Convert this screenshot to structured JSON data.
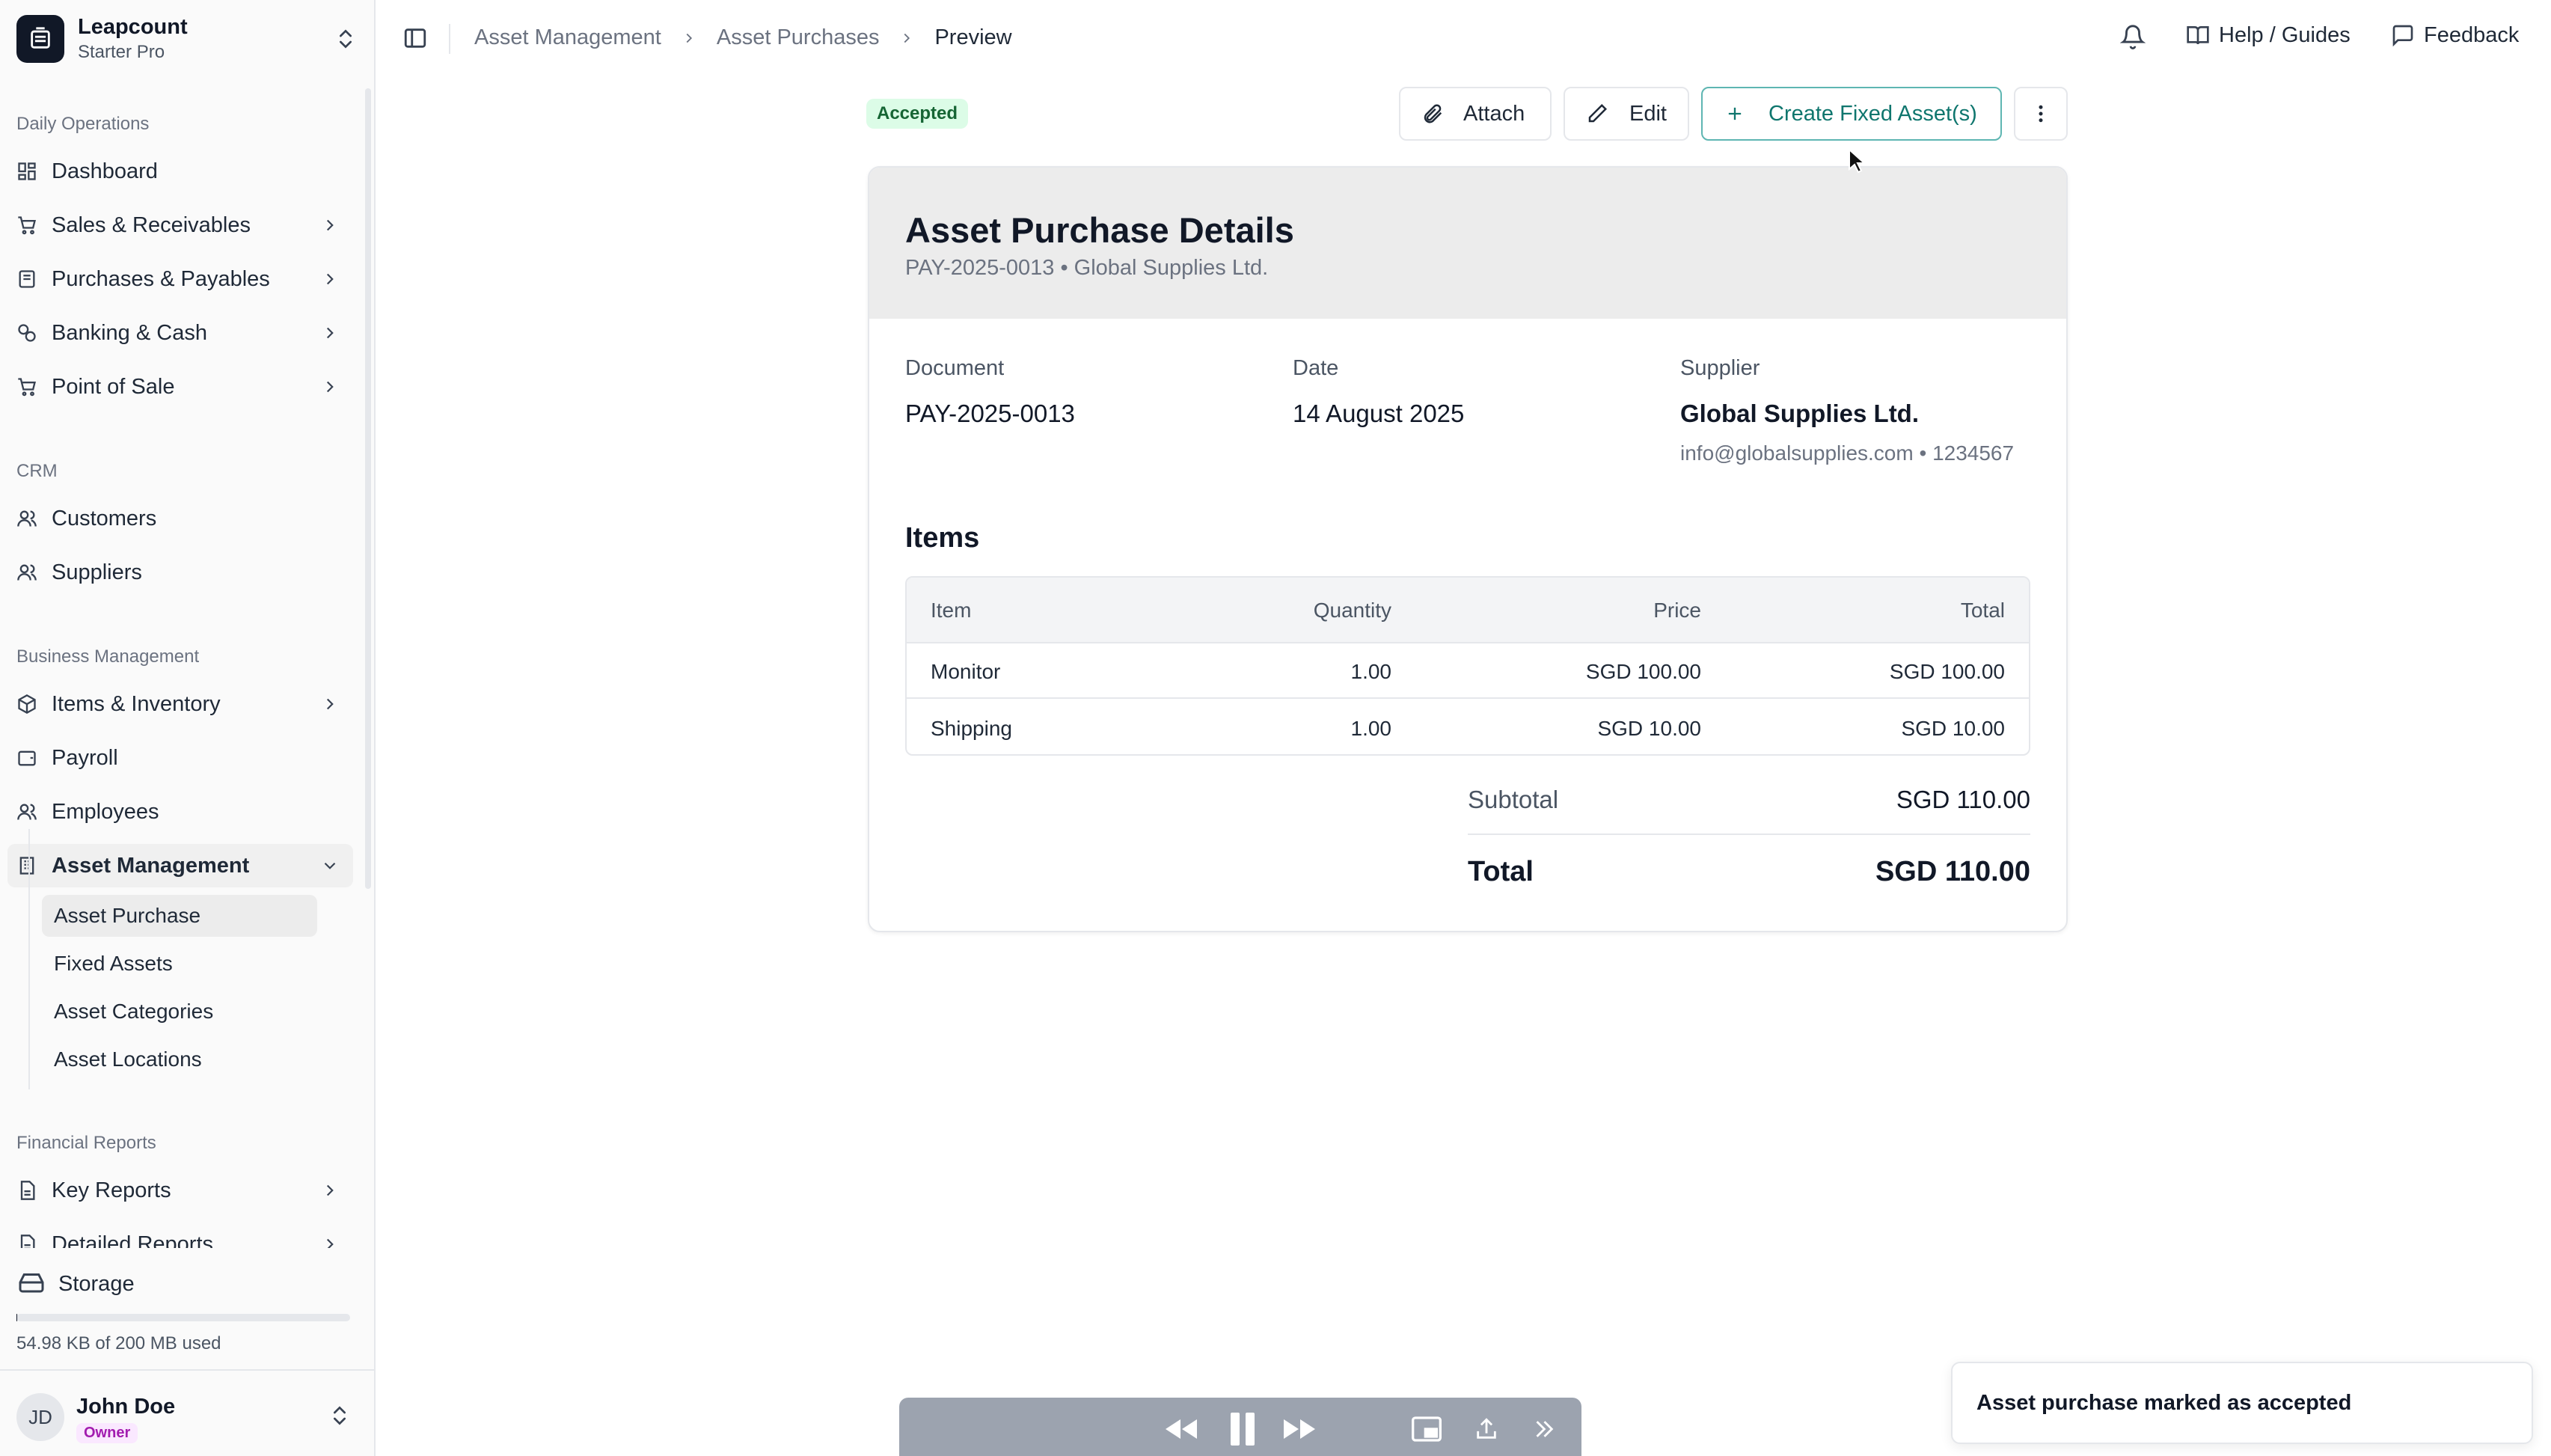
{
  "brand": {
    "name": "Leapcount",
    "plan": "Starter Pro"
  },
  "sidebar": {
    "sections": {
      "daily": "Daily Operations",
      "crm": "CRM",
      "business": "Business Management",
      "financial": "Financial Reports"
    },
    "items": {
      "dashboard": "Dashboard",
      "sales": "Sales & Receivables",
      "purchases": "Purchases & Payables",
      "banking": "Banking & Cash",
      "pos": "Point of Sale",
      "customers": "Customers",
      "suppliers": "Suppliers",
      "inventory": "Items & Inventory",
      "payroll": "Payroll",
      "employees": "Employees",
      "asset_management": "Asset Management",
      "key_reports": "Key Reports",
      "detailed_reports": "Detailed Reports"
    },
    "sub_items": {
      "asset_purchase": "Asset Purchase",
      "fixed_assets": "Fixed Assets",
      "asset_categories": "Asset Categories",
      "asset_locations": "Asset Locations"
    },
    "storage": {
      "label": "Storage",
      "usage": "54.98 KB of 200 MB used",
      "fraction": 0.00027
    }
  },
  "user": {
    "initials": "JD",
    "name": "John Doe",
    "role": "Owner"
  },
  "header": {
    "breadcrumb": [
      "Asset Management",
      "Asset Purchases",
      "Preview"
    ],
    "help_label": "Help / Guides",
    "feedback_label": "Feedback"
  },
  "toolbar": {
    "status": "Accepted",
    "attach_label": "Attach",
    "edit_label": "Edit",
    "create_label": "Create Fixed Asset(s)"
  },
  "card": {
    "title": "Asset Purchase Details",
    "subtitle": "PAY-2025-0013 • Global Supplies Ltd.",
    "document_label": "Document",
    "document_value": "PAY-2025-0013",
    "date_label": "Date",
    "date_value": "14 August 2025",
    "supplier_label": "Supplier",
    "supplier_value": "Global Supplies Ltd.",
    "supplier_contact": "info@globalsupplies.com • 1234567",
    "items_title": "Items",
    "columns": [
      "Item",
      "Quantity",
      "Price",
      "Total"
    ],
    "rows": [
      {
        "item": "Monitor",
        "quantity": "1.00",
        "price": "SGD 100.00",
        "total": "SGD 100.00"
      },
      {
        "item": "Shipping",
        "quantity": "1.00",
        "price": "SGD 10.00",
        "total": "SGD 10.00"
      }
    ],
    "subtotal_label": "Subtotal",
    "subtotal_value": "SGD 110.00",
    "total_label": "Total",
    "total_value": "SGD 110.00"
  },
  "toast": {
    "message": "Asset purchase marked as accepted"
  },
  "colors": {
    "accent": "#0f766e",
    "accent_border": "#5eb6b2",
    "badge_bg": "#dcfce7",
    "badge_text": "#166534"
  },
  "icons": {
    "brand": "inbox-stack-icon",
    "dashboard": "layout-grid-icon",
    "sales": "shopping-cart-icon",
    "purchases": "receipt-icon",
    "banking": "coins-icon",
    "pos": "cart-icon",
    "customers": "users-icon",
    "suppliers": "users-icon",
    "inventory": "package-icon",
    "payroll": "wallet-icon",
    "employees": "users-icon",
    "asset_management": "building-icon",
    "reports": "file-text-icon",
    "storage": "hard-drive-icon"
  }
}
